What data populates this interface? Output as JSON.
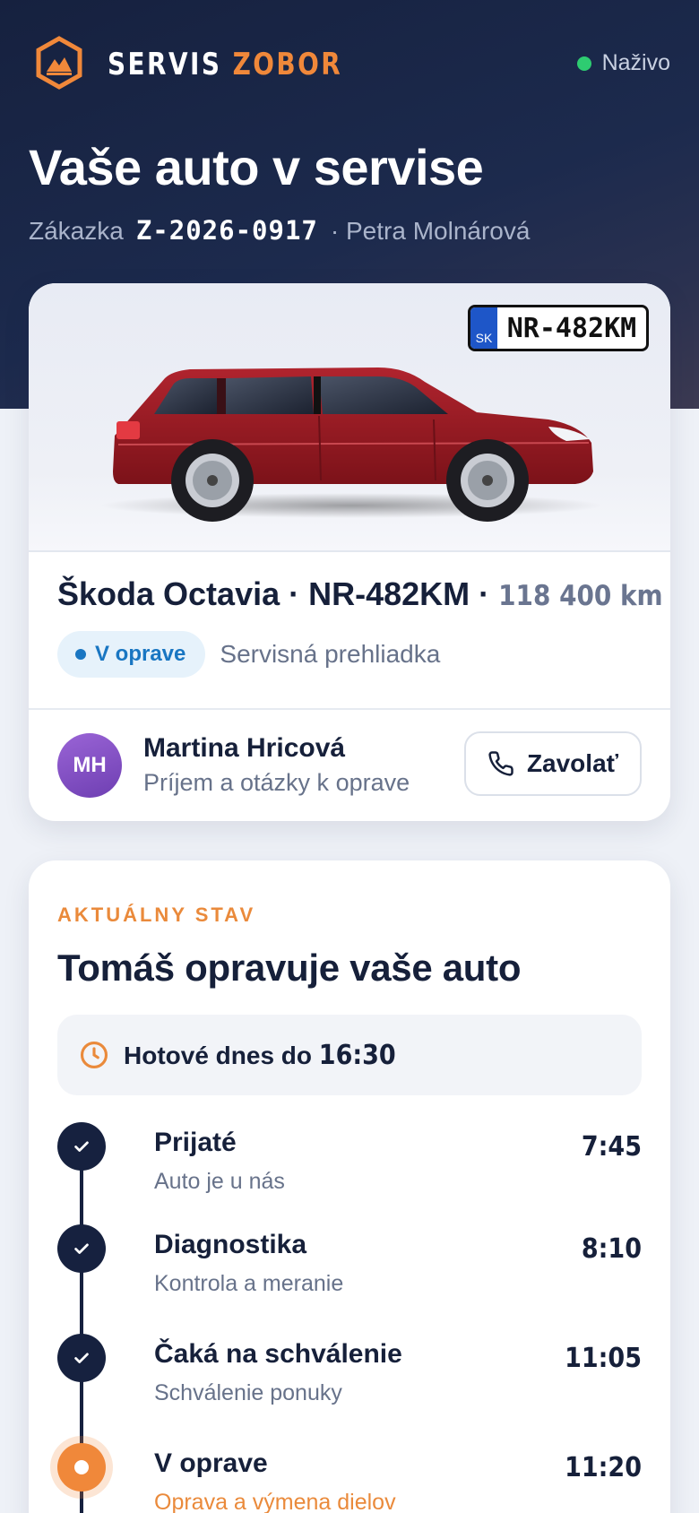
{
  "header": {
    "brand_part1": "SERVIS",
    "brand_part2": "ZOBOR",
    "live_label": "Naživo",
    "title": "Vaše auto v servise",
    "order_label": "Zákazka",
    "order_number": "Z-2026-0917",
    "customer": "· Petra Molnárová"
  },
  "vehicle": {
    "plate_country": "SK",
    "plate": "NR-482KM",
    "name_line": "Škoda Octavia · NR-482KM ·",
    "mileage": "118 400 km",
    "status_badge": "V oprave",
    "service_type": "Servisná prehliadka",
    "color": "#9b1c24"
  },
  "contact": {
    "initials": "MH",
    "name": "Martina Hricová",
    "role": "Príjem a otázky k oprave",
    "call_label": "Zavolať"
  },
  "status": {
    "eyebrow": "AKTUÁLNY STAV",
    "title": "Tomáš opravuje vaše auto",
    "eta_label": "Hotové dnes do",
    "eta_time": "16:30",
    "steps": [
      {
        "title": "Prijaté",
        "subtitle": "Auto je u nás",
        "time": "7:45",
        "state": "done"
      },
      {
        "title": "Diagnostika",
        "subtitle": "Kontrola a meranie",
        "time": "8:10",
        "state": "done"
      },
      {
        "title": "Čaká na schválenie",
        "subtitle": "Schválenie ponuky",
        "time": "11:05",
        "state": "done"
      },
      {
        "title": "V oprave",
        "subtitle": "Oprava a výmena dielov",
        "time": "11:20",
        "state": "active"
      }
    ]
  },
  "colors": {
    "accent": "#f0883a",
    "navy": "#16213f",
    "live": "#2ecc71",
    "badge_blue": "#1976c2"
  }
}
